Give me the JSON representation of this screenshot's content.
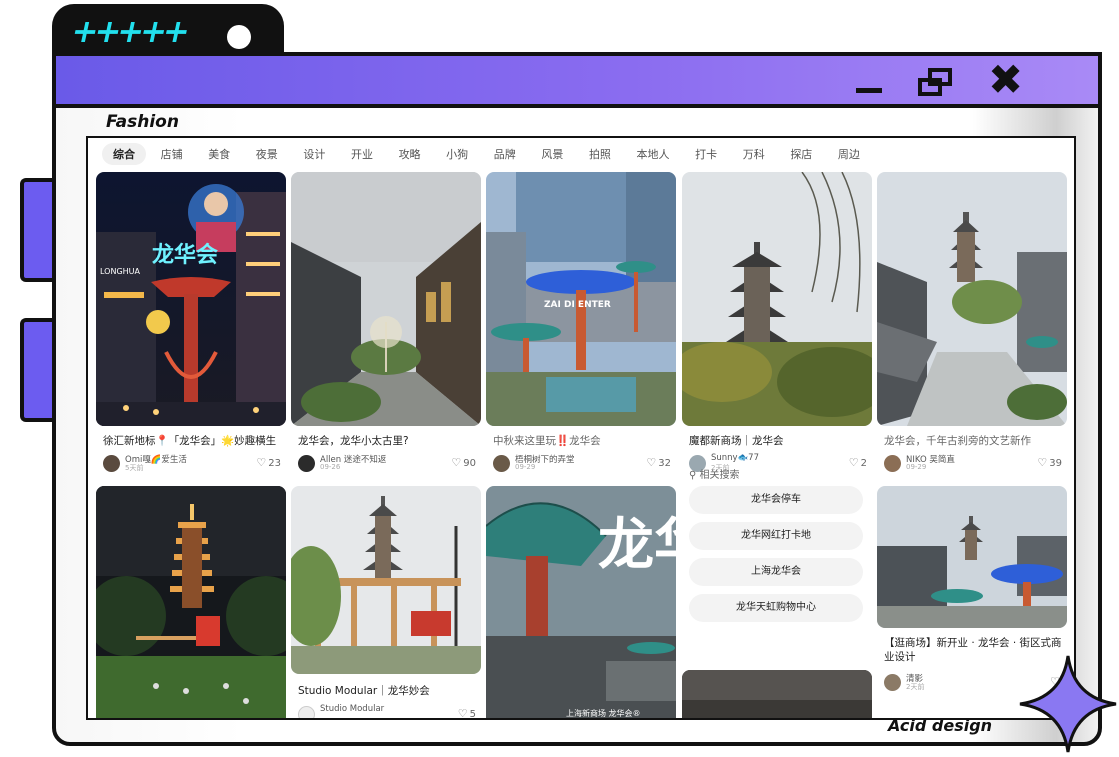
{
  "frame": {
    "tab_symbols": "+++++",
    "section_label": "Fashion",
    "footer_label": "Acid design",
    "accent": "#6c5cf0",
    "tab_color": "#22e0ee"
  },
  "categories": [
    "综合",
    "店铺",
    "美食",
    "夜景",
    "设计",
    "开业",
    "攻略",
    "小狗",
    "品牌",
    "风景",
    "拍照",
    "本地人",
    "打卡",
    "万科",
    "探店",
    "周边"
  ],
  "active_category": "综合",
  "cards": [
    {
      "title": "徐汇新地标📍「龙华会」🌟妙趣横生",
      "author": "Omi嘎🌈爱生活",
      "date": "5天前",
      "likes": "23"
    },
    {
      "title": "龙华会，龙华小太古里?",
      "author": "Allen 迷途不知返",
      "date": "09-26",
      "likes": "90"
    },
    {
      "title": "中秋来这里玩‼️龙华会",
      "author": "梧桐树下的弄堂",
      "date": "09-29",
      "likes": "32"
    },
    {
      "title": "魔都新商场｜龙华会",
      "author": "Sunny🐟77",
      "date": "2天前",
      "likes": "2"
    },
    {
      "title": "龙华会，千年古刹旁的文艺新作",
      "author": "NIKO 吴简直",
      "date": "09-29",
      "likes": "39"
    },
    {
      "title": "Studio Modular｜龙华妙会",
      "author": "Studio Modular",
      "date": "",
      "likes": "5"
    },
    {
      "title": "【逛商场】新开业 · 龙华会 · 街区式商业设计",
      "author": "清影",
      "date": "2天前",
      "likes": ""
    }
  ],
  "image_text": {
    "neon_sign": "龙华会",
    "building_sign": "LONGHUA",
    "mall_sign": "ZAI DI ENTER",
    "poster_big": "龙华会",
    "poster_small": "上海新商场 龙华会®"
  },
  "related": {
    "heading": "相关搜索",
    "items": [
      "龙华会停车",
      "龙华网红打卡地",
      "上海龙华会",
      "龙华天虹购物中心"
    ]
  }
}
